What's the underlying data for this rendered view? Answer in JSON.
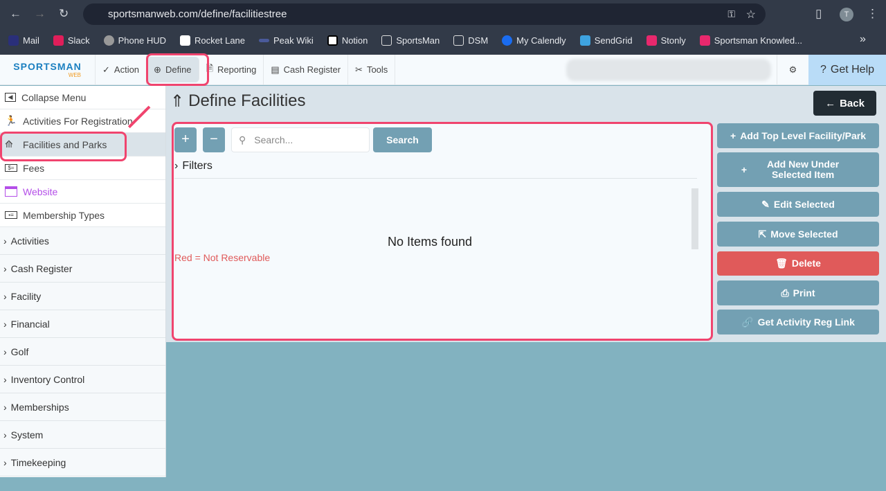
{
  "browser": {
    "url": "sportsmanweb.com/define/facilitiestree",
    "avatar": "T",
    "bookmarks": [
      "Mail",
      "Slack",
      "Phone HUD",
      "Rocket Lane",
      "Peak Wiki",
      "Notion",
      "SportsMan",
      "DSM",
      "My Calendly",
      "SendGrid",
      "Stonly",
      "Sportsman Knowled..."
    ],
    "more": "»"
  },
  "app": {
    "logo": "SPORTSMAN",
    "logo_sub": "WEB",
    "nav": [
      "Action",
      "Define",
      "Reporting",
      "Cash Register",
      "Tools"
    ],
    "help": "Get Help"
  },
  "sidebar": {
    "items": [
      "Collapse Menu",
      "Activities For Registration",
      "Facilities and Parks",
      "Fees",
      "Website",
      "Membership Types"
    ],
    "sections": [
      "Activities",
      "Cash Register",
      "Facility",
      "Financial",
      "Golf",
      "Inventory Control",
      "Memberships",
      "System",
      "Timekeeping"
    ]
  },
  "page": {
    "title": "Define Facilities",
    "back": "Back",
    "search_placeholder": "Search...",
    "search_button": "Search",
    "expand": "+",
    "collapse": "−",
    "filters": "Filters",
    "empty": "No Items found",
    "legend": "Red = Not Reservable",
    "actions": [
      "Add Top Level Facility/Park",
      "Add New Under Selected Item",
      "Edit Selected",
      "Move Selected",
      "Delete",
      "Print",
      "Get Activity Reg Link"
    ]
  },
  "colors": {
    "accent": "#73a0b3",
    "danger": "#e05a5a",
    "highlight": "#f0446e"
  }
}
